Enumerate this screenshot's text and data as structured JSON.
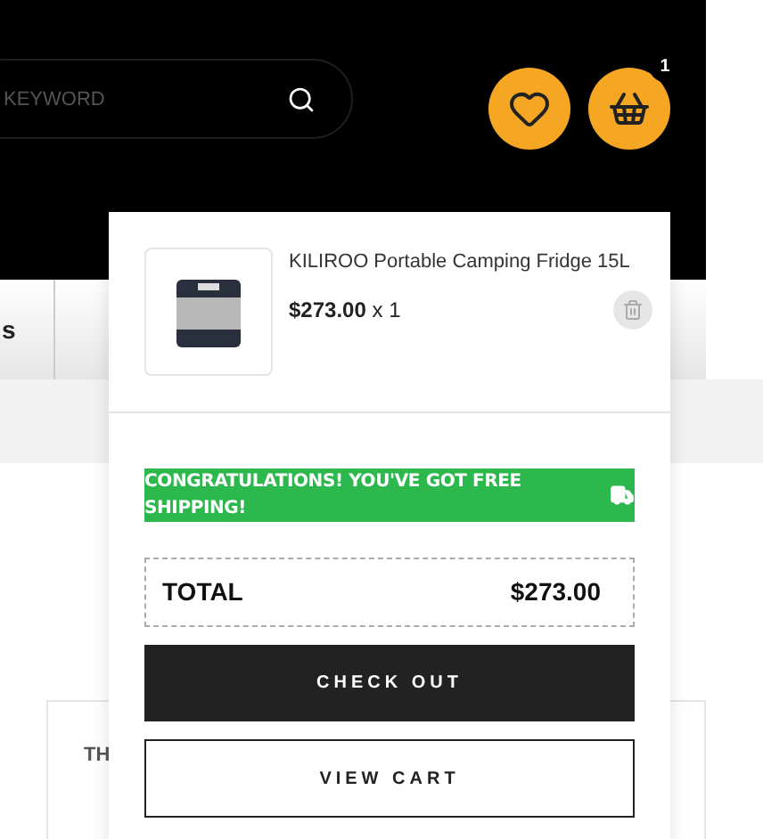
{
  "header": {
    "search": {
      "placeholder": "KEYWORD"
    },
    "cart_count": "1"
  },
  "nav": {
    "items": [
      "s"
    ]
  },
  "content": {
    "table_heading": "TH"
  },
  "mini_cart": {
    "items": [
      {
        "name": "KILIROO Portable Camping Fridge 15L",
        "price": "$273.00",
        "quantity": "x 1"
      }
    ],
    "shipping_notice": "CONGRATULATIONS! YOU'VE GOT FREE SHIPPING!",
    "total_label": "TOTAL",
    "total_value": "$273.00",
    "buttons": [
      {
        "label": "CHECK OUT",
        "kind": "primary"
      },
      {
        "label": "VIEW CART",
        "kind": "outline"
      }
    ]
  }
}
